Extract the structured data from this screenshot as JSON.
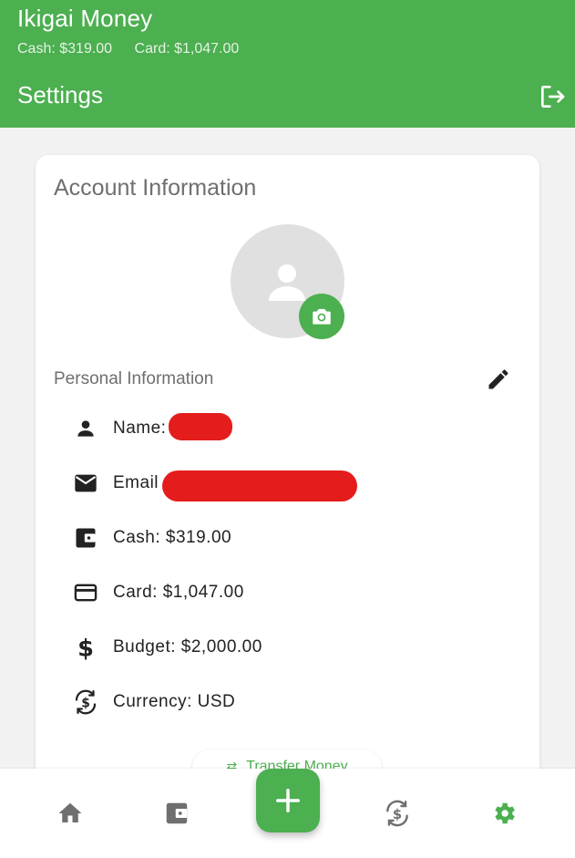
{
  "app": {
    "title": "Ikigai Money",
    "cash_balance": "Cash: $319.00",
    "card_balance": "Card: $1,047.00",
    "page_title": "Settings"
  },
  "account": {
    "title": "Account Information",
    "section_title": "Personal Information",
    "name_label": "Name:",
    "email_label": "Email",
    "cash": "Cash: $319.00",
    "card": "Card: $1,047.00",
    "budget": "Budget: $2,000.00",
    "currency": "Currency: USD",
    "transfer_label": "Transfer Money"
  },
  "icons": {
    "logout": "logout-icon",
    "camera": "camera-icon",
    "edit": "pencil-icon",
    "person": "person-icon",
    "email": "mail-icon",
    "cash": "wallet-icon",
    "card": "credit-card-icon",
    "budget": "dollar-icon",
    "currency": "currency-exchange-icon",
    "home": "home-icon",
    "add": "plus-icon",
    "settings": "gear-icon"
  },
  "colors": {
    "primary": "#4caf50",
    "redaction": "#e51c1c",
    "inactive_nav": "#6f6f6f"
  }
}
